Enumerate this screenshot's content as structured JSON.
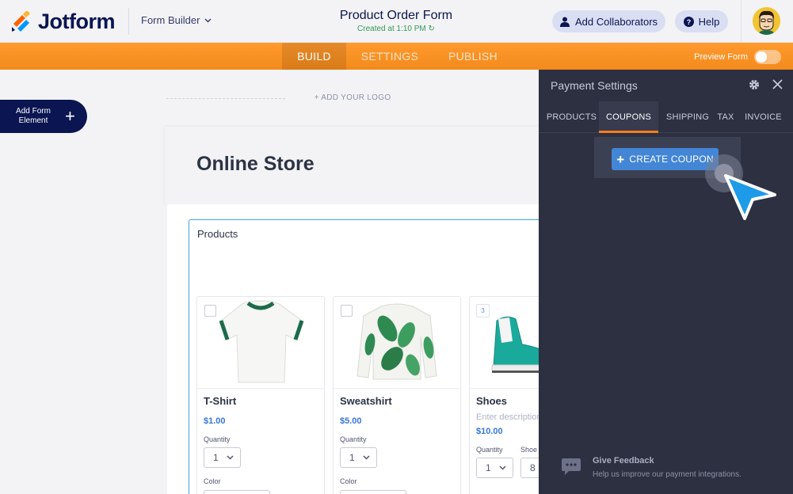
{
  "header": {
    "logo_text": "Jotform",
    "form_builder_label": "Form Builder",
    "form_title": "Product Order Form",
    "form_subtitle": "Created at 1:10 PM",
    "collaborators_label": "Add Collaborators",
    "help_label": "Help"
  },
  "nav": {
    "tabs": [
      {
        "label": "BUILD",
        "active": true
      },
      {
        "label": "SETTINGS",
        "active": false
      },
      {
        "label": "PUBLISH",
        "active": false
      }
    ],
    "preview_label": "Preview Form"
  },
  "canvas": {
    "add_element_label": "Add Form Element",
    "add_logo_label": "+ ADD YOUR LOGO",
    "store_title": "Online Store",
    "products_label": "Products",
    "cards": [
      {
        "name": "T-Shirt",
        "price": "$1.00",
        "quantity_label": "Quantity",
        "quantity_value": "1",
        "color_label": "Color"
      },
      {
        "name": "Sweatshirt",
        "price": "$5.00",
        "quantity_label": "Quantity",
        "quantity_value": "1",
        "color_label": "Color"
      },
      {
        "name": "Shoes",
        "badge": "3",
        "description_placeholder": "Enter description",
        "price": "$10.00",
        "quantity_label": "Quantity",
        "quantity_value": "1",
        "size_label": "Shoe",
        "size_value": "8"
      }
    ]
  },
  "panel": {
    "title": "Payment Settings",
    "tabs": [
      {
        "label": "PRODUCTS",
        "active": false
      },
      {
        "label": "COUPONS",
        "active": true
      },
      {
        "label": "SHIPPING",
        "active": false
      },
      {
        "label": "TAX",
        "active": false
      },
      {
        "label": "INVOICE",
        "active": false
      }
    ],
    "create_coupon_label": "CREATE COUPON",
    "feedback_title": "Give Feedback",
    "feedback_sub": "Help us improve our payment integrations."
  },
  "colors": {
    "navy": "#0a1551",
    "orange": "#ff9a2e",
    "panel_bg": "#2d3040",
    "blue_button": "#4386d6",
    "cursor_blue": "#1e9be8"
  }
}
